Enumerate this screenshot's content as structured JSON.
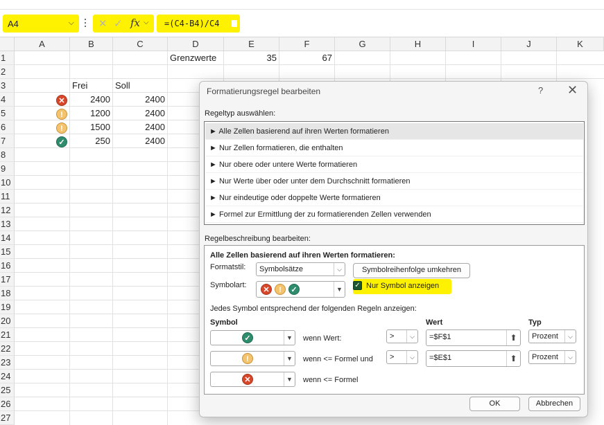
{
  "formula_bar": {
    "name_box": "A4",
    "formula": "=(C4-B4)/C4",
    "fx": "fx"
  },
  "columns": [
    "A",
    "B",
    "C",
    "D",
    "E",
    "F",
    "G",
    "H",
    "I",
    "J",
    "K"
  ],
  "rows": [
    "1",
    "2",
    "3",
    "4",
    "5",
    "6",
    "7",
    "8",
    "9",
    "10",
    "11",
    "12",
    "13",
    "14",
    "15",
    "16",
    "17",
    "18",
    "19",
    "20",
    "21",
    "22",
    "23",
    "24",
    "25",
    "26",
    "27"
  ],
  "cells": {
    "D1": "Grenzwerte",
    "E1": "35",
    "F1": "67",
    "B3": "Frei",
    "C3": "Soll",
    "B4": "2400",
    "C4": "2400",
    "B5": "1200",
    "C5": "2400",
    "B6": "1500",
    "C6": "2400",
    "B7": "250",
    "C7": "2400"
  },
  "icons_col_a": [
    "x-circle-icon",
    "exclamation-circle-icon",
    "exclamation-circle-icon",
    "check-circle-icon"
  ],
  "dialog": {
    "title": "Formatierungsregel bearbeiten",
    "help": "?",
    "close": "✕",
    "ruletype_label": "Regeltyp auswählen:",
    "rule_types": [
      "Alle Zellen basierend auf ihren Werten formatieren",
      "Nur Zellen formatieren, die enthalten",
      "Nur obere oder untere Werte formatieren",
      "Nur Werte über oder unter dem Durchschnitt formatieren",
      "Nur eindeutige oder doppelte Werte formatieren",
      "Formel zur Ermittlung der zu formatierenden Zellen verwenden"
    ],
    "description_label": "Regelbeschreibung bearbeiten:",
    "description_heading": "Alle Zellen basierend auf ihren Werten formatieren:",
    "formatstil_label": "Formatstil:",
    "formatstil_value": "Symbolsätze",
    "reverse_button": "Symbolreihenfolge umkehren",
    "symbolart_label": "Symbolart:",
    "show_icon_only_label": "Nur Symbol anzeigen",
    "show_icon_only_checked": true,
    "rules_intro": "Jedes Symbol entsprechend der folgenden Regeln anzeigen:",
    "col_symbol": "Symbol",
    "col_wert": "Wert",
    "col_typ": "Typ",
    "rules": [
      {
        "icon": "check-circle-icon",
        "text": "wenn Wert:",
        "op": ">",
        "value": "=$F$1",
        "type": "Prozent"
      },
      {
        "icon": "exclamation-circle-icon",
        "text": "wenn <= Formel und",
        "op": ">",
        "value": "=$E$1",
        "type": "Prozent"
      },
      {
        "icon": "x-circle-icon",
        "text": "wenn <= Formel"
      }
    ],
    "ok": "OK",
    "cancel": "Abbrechen"
  },
  "colors": {
    "highlight": "#fff200",
    "red_icon": "#d9472b",
    "yellow_icon": "#f4c36e",
    "green_icon": "#2f8c6c"
  }
}
